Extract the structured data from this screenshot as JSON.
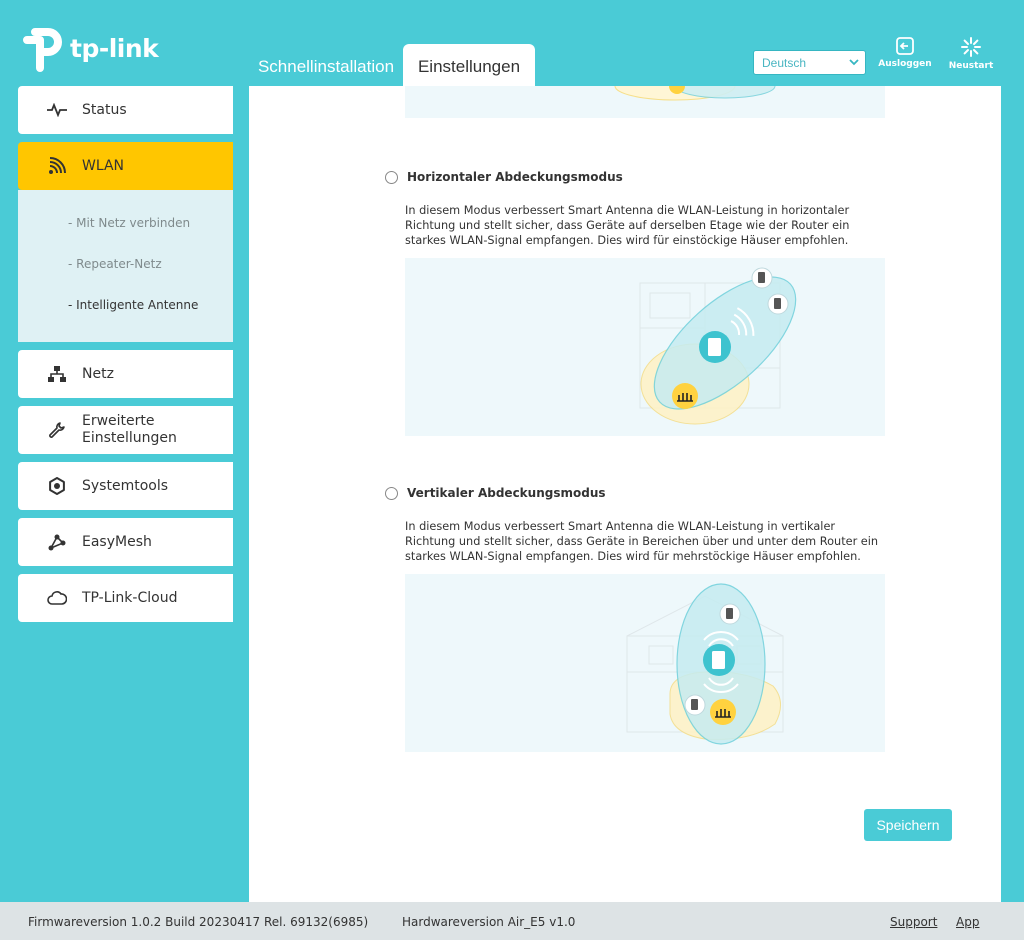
{
  "brand": {
    "logo_text": "tp-link"
  },
  "header": {
    "tabs": [
      {
        "label": "Schnellinstallation"
      },
      {
        "label": "Einstellungen"
      }
    ],
    "language": {
      "selected": "Deutsch"
    },
    "actions": {
      "logout_label": "Ausloggen",
      "restart_label": "Neustart"
    }
  },
  "sidebar": {
    "items": [
      {
        "label": "Status",
        "icon": "pulse-icon"
      },
      {
        "label": "WLAN",
        "icon": "wifi-icon"
      },
      {
        "label": "Netz",
        "icon": "network-icon"
      },
      {
        "label": "Erweiterte Einstellungen",
        "icon": "wrench-icon"
      },
      {
        "label": "Systemtools",
        "icon": "gear-icon"
      },
      {
        "label": "EasyMesh",
        "icon": "mesh-icon"
      },
      {
        "label": "TP-Link-Cloud",
        "icon": "cloud-icon"
      }
    ],
    "wlan_sub": [
      {
        "label": "- Mit Netz verbinden"
      },
      {
        "label": "- Repeater-Netz"
      },
      {
        "label": "- Intelligente Antenne"
      }
    ]
  },
  "main": {
    "horizontal": {
      "title": "Horizontaler Abdeckungsmodus",
      "desc": "In diesem Modus verbessert Smart Antenna die WLAN-Leistung in horizontaler Richtung und stellt sicher, dass Geräte auf derselben Etage wie der Router ein starkes WLAN-Signal empfangen. Dies wird für einstöckige Häuser empfohlen."
    },
    "vertical": {
      "title": "Vertikaler Abdeckungsmodus",
      "desc": "In diesem Modus verbessert Smart Antenna die WLAN-Leistung in vertikaler Richtung und stellt sicher, dass Geräte in Bereichen über und unter dem Router ein starkes WLAN-Signal empfangen. Dies wird für mehrstöckige Häuser empfohlen."
    },
    "save_label": "Speichern"
  },
  "footer": {
    "firmware": "Firmwareversion 1.0.2 Build 20230417 Rel. 69132(6985)",
    "hardware": "Hardwareversion Air_E5 v1.0",
    "support": "Support",
    "app": "App"
  },
  "colors": {
    "accent": "#4acbd6",
    "active": "#ffc600",
    "sub_bg": "#dff1f4"
  }
}
